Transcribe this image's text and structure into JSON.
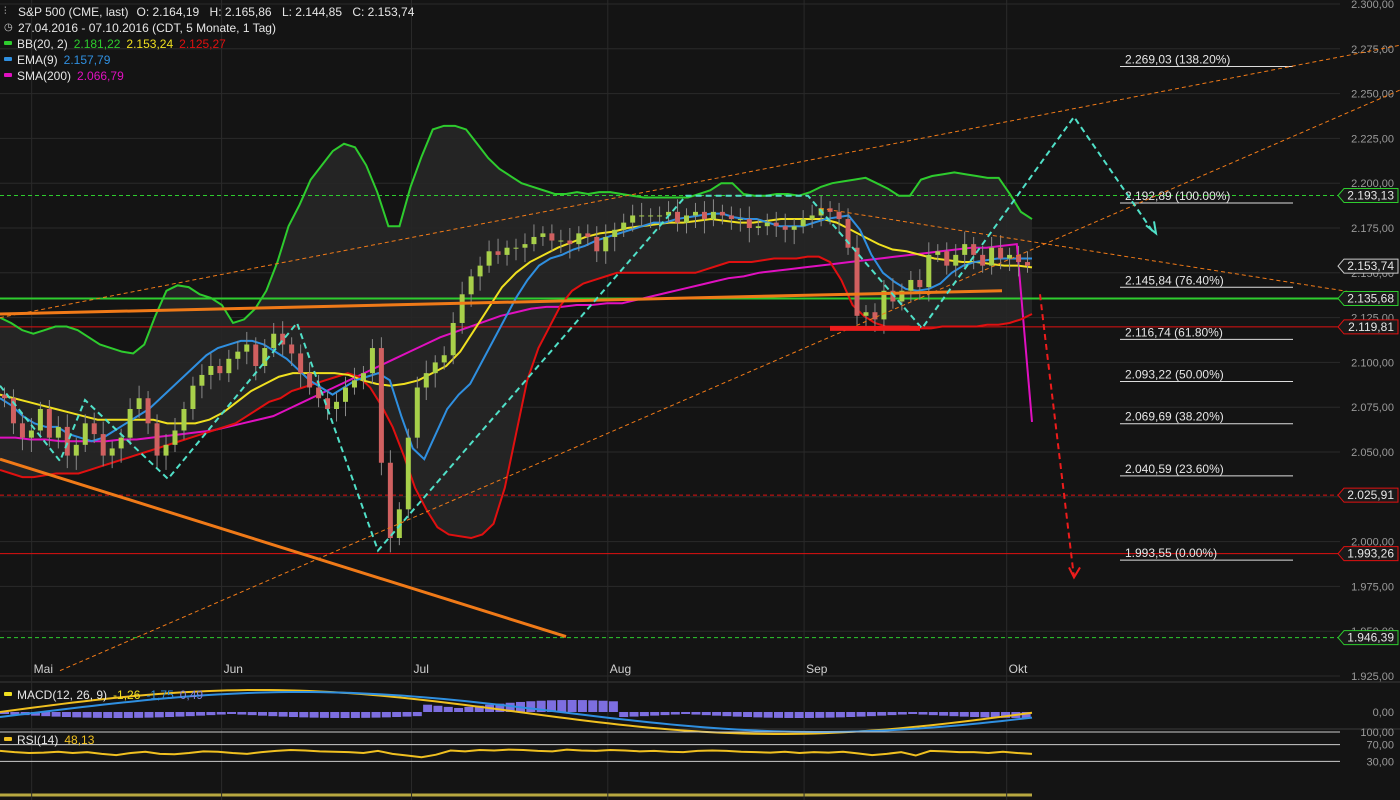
{
  "header": {
    "symbol_line": "S&P 500 (CME, last)",
    "open": "O: 2.164,19",
    "high": "H: 2.165,86",
    "low": "L: 2.144,85",
    "close": "C: 2.153,74",
    "range_line": "27.04.2016 - 07.10.2016 (CDT, 5 Monate, 1 Tag)"
  },
  "legend": {
    "bb": {
      "label": "BB(20, 2)",
      "v1": "2.181,22",
      "v2": "2.153,24",
      "v3": "2.125,27"
    },
    "ema": {
      "label": "EMA(9)",
      "v1": "2.157,79"
    },
    "sma": {
      "label": "SMA(200)",
      "v1": "2.066,79"
    },
    "macd": {
      "label": "MACD(12, 26, 9)",
      "v1": "-1,26",
      "v2": "-1,75",
      "v3": "0,49"
    },
    "rsi": {
      "label": "RSI(14)",
      "v1": "48,13"
    }
  },
  "colors": {
    "background": "#141414",
    "grid": "#2a2a2a",
    "up": "#a8d04a",
    "down": "#d06060",
    "bb_outer": "#2ecc2e",
    "bb_mid": "#f0e020",
    "bb_lower": "#e01010",
    "ema": "#2f8fe0",
    "sma": "#e010c0",
    "fib": "#dddddd",
    "support": "#2ecc2e",
    "trend_orange": "#f07a18",
    "zigzag": "#50e0c8",
    "forecast_red": "#ee1c1c"
  },
  "chart_data": {
    "type": "candlestick",
    "x_axis_labels": [
      {
        "label": "Mai",
        "date": "2016-05-02"
      },
      {
        "label": "Jun",
        "date": "2016-06-01"
      },
      {
        "label": "Jul",
        "date": "2016-07-01"
      },
      {
        "label": "Aug",
        "date": "2016-08-01"
      },
      {
        "label": "Sep",
        "date": "2016-09-01"
      },
      {
        "label": "Okt",
        "date": "2016-10-03"
      }
    ],
    "date_range": [
      "2016-04-27",
      "2016-10-07"
    ],
    "ylim": [
      1925,
      2300
    ],
    "y_ticks": [
      "1.925,00",
      "1.950,00",
      "1.975,00",
      "2.000,00",
      "2.025,00",
      "2.050,00",
      "2.075,00",
      "2.100,00",
      "2.125,00",
      "2.150,00",
      "2.175,00",
      "2.200,00",
      "2.225,00",
      "2.250,00",
      "2.275,00",
      "2.300,00"
    ],
    "y_tick_values": [
      1925,
      1950,
      1975,
      2000,
      2025,
      2050,
      2075,
      2100,
      2125,
      2150,
      2175,
      2200,
      2225,
      2250,
      2275,
      2300
    ],
    "closes": [
      2080,
      2066,
      2058,
      2062,
      2074,
      2058,
      2064,
      2048,
      2054,
      2066,
      2060,
      2048,
      2052,
      2058,
      2074,
      2080,
      2066,
      2048,
      2054,
      2062,
      2074,
      2087,
      2093,
      2098,
      2094,
      2102,
      2106,
      2110,
      2098,
      2108,
      2116,
      2110,
      2105,
      2094,
      2086,
      2080,
      2074,
      2078,
      2086,
      2090,
      2094,
      2108,
      2044,
      2002,
      2018,
      2058,
      2086,
      2094,
      2100,
      2104,
      2122,
      2138,
      2148,
      2154,
      2162,
      2160,
      2164,
      2164,
      2166,
      2170,
      2172,
      2168,
      2168,
      2166,
      2172,
      2170,
      2162,
      2170,
      2174,
      2178,
      2182,
      2182,
      2182,
      2182,
      2184,
      2178,
      2182,
      2184,
      2180,
      2184,
      2182,
      2180,
      2180,
      2175,
      2176,
      2178,
      2176,
      2174,
      2176,
      2180,
      2182,
      2186,
      2184,
      2180,
      2164,
      2126,
      2128,
      2124,
      2140,
      2134,
      2140,
      2146,
      2142,
      2160,
      2162,
      2154,
      2160,
      2166,
      2160,
      2154,
      2164,
      2158,
      2160,
      2156,
      2154
    ],
    "bb_upper": [
      2125,
      2122,
      2118,
      2116,
      2118,
      2120,
      2120,
      2118,
      2114,
      2110,
      2108,
      2106,
      2105,
      2110,
      2126,
      2140,
      2143,
      2142,
      2138,
      2136,
      2132,
      2122,
      2124,
      2130,
      2140,
      2156,
      2176,
      2188,
      2202,
      2210,
      2218,
      2222,
      2220,
      2210,
      2195,
      2176,
      2176,
      2198,
      2215,
      2230,
      2232,
      2232,
      2230,
      2222,
      2214,
      2208,
      2204,
      2200,
      2198,
      2196,
      2194,
      2194,
      2195,
      2194,
      2195,
      2195,
      2194,
      2193,
      2192,
      2192,
      2192,
      2192,
      2192,
      2194,
      2196,
      2200,
      2200,
      2194,
      2193,
      2193,
      2194,
      2194,
      2193,
      2195,
      2198,
      2200,
      2201,
      2202,
      2203,
      2200,
      2197,
      2193,
      2193,
      2202,
      2204,
      2205,
      2206,
      2205,
      2204,
      2203,
      2203,
      2194,
      2184,
      2180
    ],
    "bb_lower": [
      2040,
      2038,
      2036,
      2036,
      2037,
      2038,
      2038,
      2038,
      2040,
      2042,
      2044,
      2046,
      2048,
      2050,
      2052,
      2054,
      2056,
      2058,
      2060,
      2062,
      2064,
      2066,
      2070,
      2074,
      2078,
      2080,
      2084,
      2086,
      2088,
      2090,
      2092,
      2094,
      2092,
      2086,
      2076,
      2064,
      2048,
      2030,
      2018,
      2008,
      2004,
      2003,
      2002,
      2004,
      2010,
      2030,
      2060,
      2090,
      2108,
      2120,
      2132,
      2140,
      2144,
      2146,
      2148,
      2150,
      2150,
      2150,
      2150,
      2150,
      2150,
      2150,
      2150,
      2152,
      2154,
      2156,
      2156,
      2156,
      2157,
      2158,
      2158,
      2158,
      2159,
      2159,
      2156,
      2146,
      2132,
      2126,
      2122,
      2120,
      2120,
      2120,
      2119,
      2119,
      2120,
      2120,
      2120,
      2120,
      2121,
      2121,
      2122,
      2124,
      2127
    ],
    "bb_mid": [
      2082,
      2080,
      2078,
      2076,
      2074,
      2072,
      2070,
      2068,
      2068,
      2068,
      2068,
      2068,
      2066,
      2066,
      2066,
      2068,
      2072,
      2078,
      2084,
      2088,
      2092,
      2094,
      2094,
      2094,
      2094,
      2093,
      2090,
      2088,
      2087,
      2088,
      2090,
      2094,
      2098,
      2106,
      2118,
      2130,
      2142,
      2150,
      2156,
      2160,
      2164,
      2167,
      2170,
      2172,
      2173,
      2175,
      2176,
      2177,
      2178,
      2178,
      2179,
      2180,
      2179,
      2178,
      2178,
      2179,
      2180,
      2180,
      2180,
      2180,
      2178,
      2174,
      2170,
      2166,
      2163,
      2162,
      2160,
      2158,
      2157,
      2156,
      2156,
      2155,
      2154,
      2154,
      2153
    ],
    "ema9": [
      2080,
      2076,
      2070,
      2066,
      2064,
      2064,
      2060,
      2058,
      2056,
      2058,
      2062,
      2066,
      2070,
      2074,
      2080,
      2086,
      2092,
      2098,
      2104,
      2108,
      2110,
      2112,
      2112,
      2110,
      2106,
      2102,
      2096,
      2090,
      2086,
      2082,
      2086,
      2090,
      2092,
      2094,
      2090,
      2070,
      2052,
      2046,
      2060,
      2074,
      2082,
      2088,
      2100,
      2112,
      2124,
      2136,
      2146,
      2154,
      2158,
      2160,
      2163,
      2165,
      2168,
      2170,
      2172,
      2174,
      2176,
      2178,
      2178,
      2180,
      2181,
      2182,
      2183,
      2183,
      2181,
      2180,
      2180,
      2178,
      2176,
      2176,
      2176,
      2178,
      2180,
      2181,
      2182,
      2174,
      2160,
      2150,
      2145,
      2141,
      2140,
      2141,
      2144,
      2150,
      2154,
      2156,
      2157,
      2158,
      2158,
      2158,
      2158
    ],
    "sma200": [
      2058,
      2058,
      2057,
      2057,
      2056,
      2056,
      2056,
      2056,
      2057,
      2057,
      2058,
      2059,
      2060,
      2061,
      2062,
      2064,
      2066,
      2068,
      2070,
      2074,
      2078,
      2082,
      2086,
      2090,
      2094,
      2098,
      2102,
      2106,
      2110,
      2114,
      2117,
      2120,
      2123,
      2126,
      2128,
      2130,
      2131,
      2131,
      2132,
      2132,
      2133,
      2133,
      2135,
      2137,
      2139,
      2141,
      2143,
      2145,
      2147,
      2148,
      2150,
      2151,
      2152,
      2153,
      2154,
      2155,
      2156,
      2157,
      2158,
      2159,
      2160,
      2161,
      2162,
      2163,
      2164,
      2164,
      2165,
      2166,
      2066.79
    ],
    "support_level": 2135.68,
    "price_boxes": [
      "2.193,13",
      "2.153,74",
      "2.135,68",
      "2.119,81",
      "2.025,91",
      "1.993,26",
      "1.946,39"
    ],
    "price_box_values": [
      2193.13,
      2153.74,
      2135.68,
      2119.81,
      2025.91,
      1993.26,
      1946.39
    ],
    "fibonacci": [
      {
        "label": "2.269,03 (138.20%)",
        "value": 2269.03
      },
      {
        "label": "2.192,89 (100.00%)",
        "value": 2192.89
      },
      {
        "label": "2.145,84 (76.40%)",
        "value": 2145.84
      },
      {
        "label": "2.116,74 (61.80%)",
        "value": 2116.74
      },
      {
        "label": "2.093,22 (50.00%)",
        "value": 2093.22
      },
      {
        "label": "2.069,69 (38.20%)",
        "value": 2069.69
      },
      {
        "label": "2.040,59 (23.60%)",
        "value": 2040.59
      },
      {
        "label": "1.993,55 (0.00%)",
        "value": 1993.55
      }
    ],
    "macd_ticks": [
      "0,00"
    ],
    "rsi_ticks": [
      "100,00",
      "70,00",
      "30,00"
    ],
    "rsi_values": [
      55,
      52,
      50,
      51,
      53,
      50,
      52,
      48,
      45,
      50,
      53,
      48,
      47,
      50,
      54,
      53,
      50,
      48,
      52,
      55,
      57,
      56,
      54,
      53,
      52,
      50,
      55,
      48,
      44,
      40,
      46,
      56,
      54,
      57,
      56,
      58,
      57,
      55,
      54,
      58,
      56,
      55,
      57,
      56,
      54,
      55,
      53,
      52,
      55,
      56,
      55,
      53,
      52,
      51,
      53,
      50,
      52,
      51,
      53,
      49,
      45,
      48,
      52,
      44,
      55,
      54,
      52,
      52,
      50,
      53,
      50,
      48
    ]
  }
}
